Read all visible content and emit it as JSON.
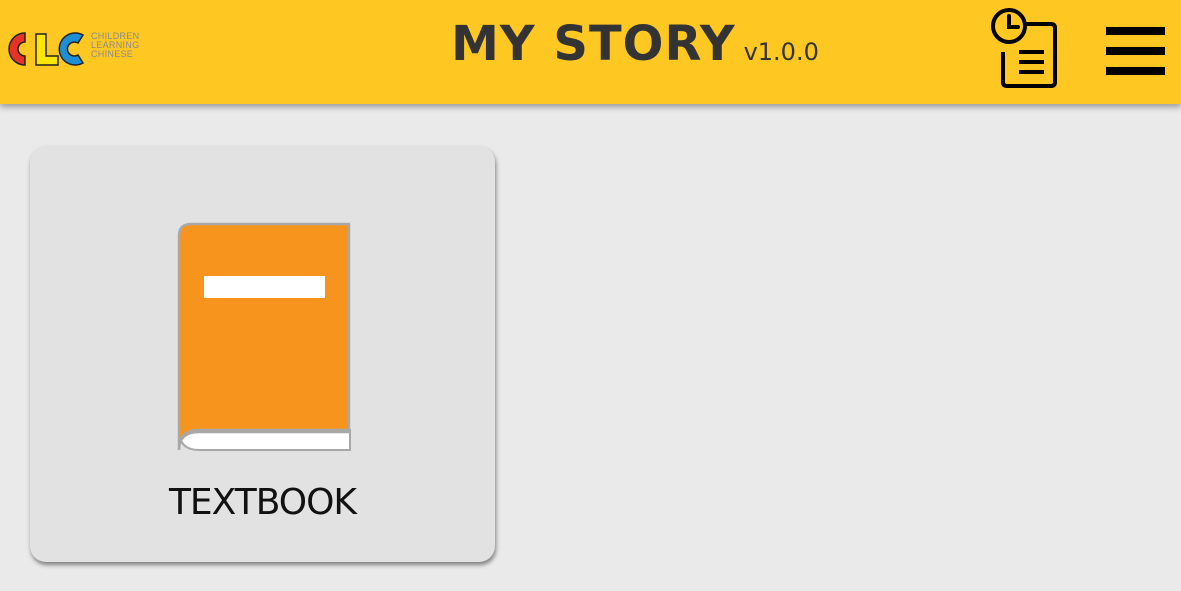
{
  "header": {
    "logo": {
      "letters": "CLC",
      "text_lines": [
        "CHILDREN",
        "LEARNING",
        "CHINESE"
      ]
    },
    "title": "MY STORY",
    "version": "v1.0.0",
    "history_icon": "history-clipboard-icon",
    "menu_icon": "hamburger-menu-icon",
    "background_color": "#fec721"
  },
  "main": {
    "cards": [
      {
        "label": "TEXTBOOK",
        "icon": "book-icon",
        "icon_color": "#f7941e"
      }
    ]
  }
}
